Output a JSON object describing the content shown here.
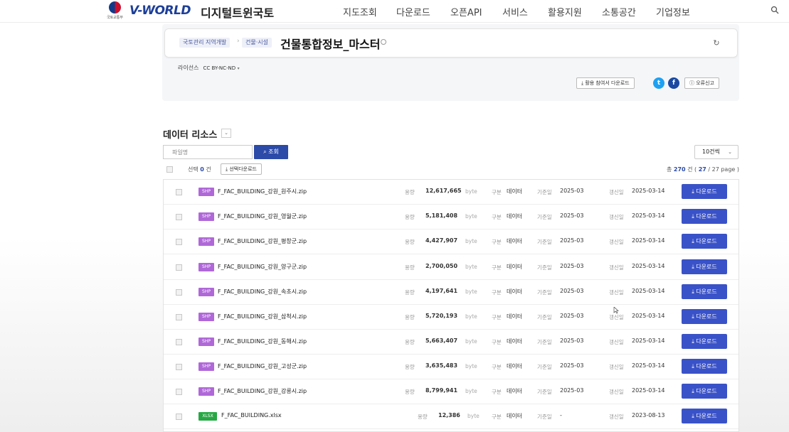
{
  "header": {
    "emblem_text": "국토교통부",
    "logo": "V-WORLD",
    "logo_sub": "디지털트윈국토",
    "nav": [
      "지도조회",
      "다운로드",
      "오픈API",
      "서비스",
      "활용지원",
      "소통공간",
      "기업정보"
    ],
    "search_icon": "search-icon"
  },
  "info": {
    "crumbs": [
      "국토관리 지역개발",
      "건물·시설"
    ],
    "title": "건물통합정보_마스터",
    "share_icon": "↻",
    "license_label": "라이선스",
    "license_value": "CC BY-NC-ND",
    "guide_download": "활용 참여서 다운로드",
    "report_button": "오류신고",
    "twitter_color": "#1da1f2",
    "facebook_color": "#1b4aa0"
  },
  "resources": {
    "title": "데이터 리소스",
    "search_placeholder": "파일명",
    "search_button": "조회",
    "per_page": "10건씩",
    "selected_label": "선택",
    "selected_count": "0",
    "selected_unit": "건",
    "selected_download": "선택다운로드",
    "summary_prefix": "총",
    "summary_count": "270",
    "summary_mid": "건 (",
    "summary_page": "27",
    "summary_suffix": "/ 27 page )"
  },
  "labels": {
    "size": "용량",
    "unit": "byte",
    "kind": "구분",
    "base": "기준일",
    "updated": "갱신일",
    "download": "다운로드"
  },
  "rows": [
    {
      "type": "SHP",
      "name": "F_FAC_BUILDING_강원_원주시.zip",
      "size": "12,617,665",
      "kind": "데이터",
      "base": "2025-03",
      "updated": "2025-03-14"
    },
    {
      "type": "SHP",
      "name": "F_FAC_BUILDING_강원_영월군.zip",
      "size": "5,181,408",
      "kind": "데이터",
      "base": "2025-03",
      "updated": "2025-03-14"
    },
    {
      "type": "SHP",
      "name": "F_FAC_BUILDING_강원_평창군.zip",
      "size": "4,427,907",
      "kind": "데이터",
      "base": "2025-03",
      "updated": "2025-03-14"
    },
    {
      "type": "SHP",
      "name": "F_FAC_BUILDING_강원_양구군.zip",
      "size": "2,700,050",
      "kind": "데이터",
      "base": "2025-03",
      "updated": "2025-03-14"
    },
    {
      "type": "SHP",
      "name": "F_FAC_BUILDING_강원_속초시.zip",
      "size": "4,197,641",
      "kind": "데이터",
      "base": "2025-03",
      "updated": "2025-03-14"
    },
    {
      "type": "SHP",
      "name": "F_FAC_BUILDING_강원_삼척시.zip",
      "size": "5,720,193",
      "kind": "데이터",
      "base": "2025-03",
      "updated": "2025-03-14"
    },
    {
      "type": "SHP",
      "name": "F_FAC_BUILDING_강원_동해시.zip",
      "size": "5,663,407",
      "kind": "데이터",
      "base": "2025-03",
      "updated": "2025-03-14"
    },
    {
      "type": "SHP",
      "name": "F_FAC_BUILDING_강원_고성군.zip",
      "size": "3,635,483",
      "kind": "데이터",
      "base": "2025-03",
      "updated": "2025-03-14"
    },
    {
      "type": "SHP",
      "name": "F_FAC_BUILDING_강원_강릉시.zip",
      "size": "8,799,941",
      "kind": "데이터",
      "base": "2025-03",
      "updated": "2025-03-14"
    },
    {
      "type": "XLSX",
      "name": "F_FAC_BUILDING.xlsx",
      "size": "12,386",
      "kind": "데이터",
      "base": "-",
      "updated": "2023-08-13"
    }
  ],
  "colors": {
    "shp_badge": "#b068d8",
    "xlsx_badge": "#27a845",
    "primary": "#3a52c8"
  }
}
